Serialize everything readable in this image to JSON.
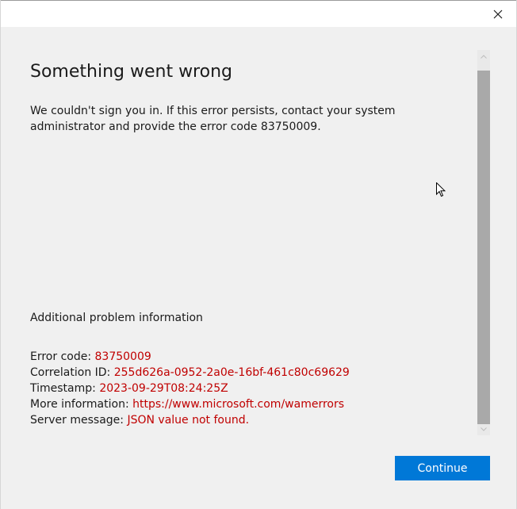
{
  "titlebar": {
    "close_icon": "close-icon"
  },
  "error": {
    "heading": "Something went wrong",
    "message": "We couldn't sign you in. If this error persists, contact your system administrator and provide the error code 83750009."
  },
  "additional": {
    "title": "Additional problem information",
    "rows": [
      {
        "label": "Error code: ",
        "value": "83750009"
      },
      {
        "label": "Correlation ID: ",
        "value": "255d626a-0952-2a0e-16bf-461c80c69629"
      },
      {
        "label": "Timestamp: ",
        "value": "2023-09-29T08:24:25Z"
      },
      {
        "label": "More information: ",
        "value": "https://www.microsoft.com/wamerrors"
      },
      {
        "label": "Server message: ",
        "value": "JSON value not found."
      }
    ]
  },
  "actions": {
    "continue_label": "Continue"
  },
  "colors": {
    "accent": "#0078d7",
    "error_value": "#c00000",
    "background": "#f0f0f0"
  }
}
